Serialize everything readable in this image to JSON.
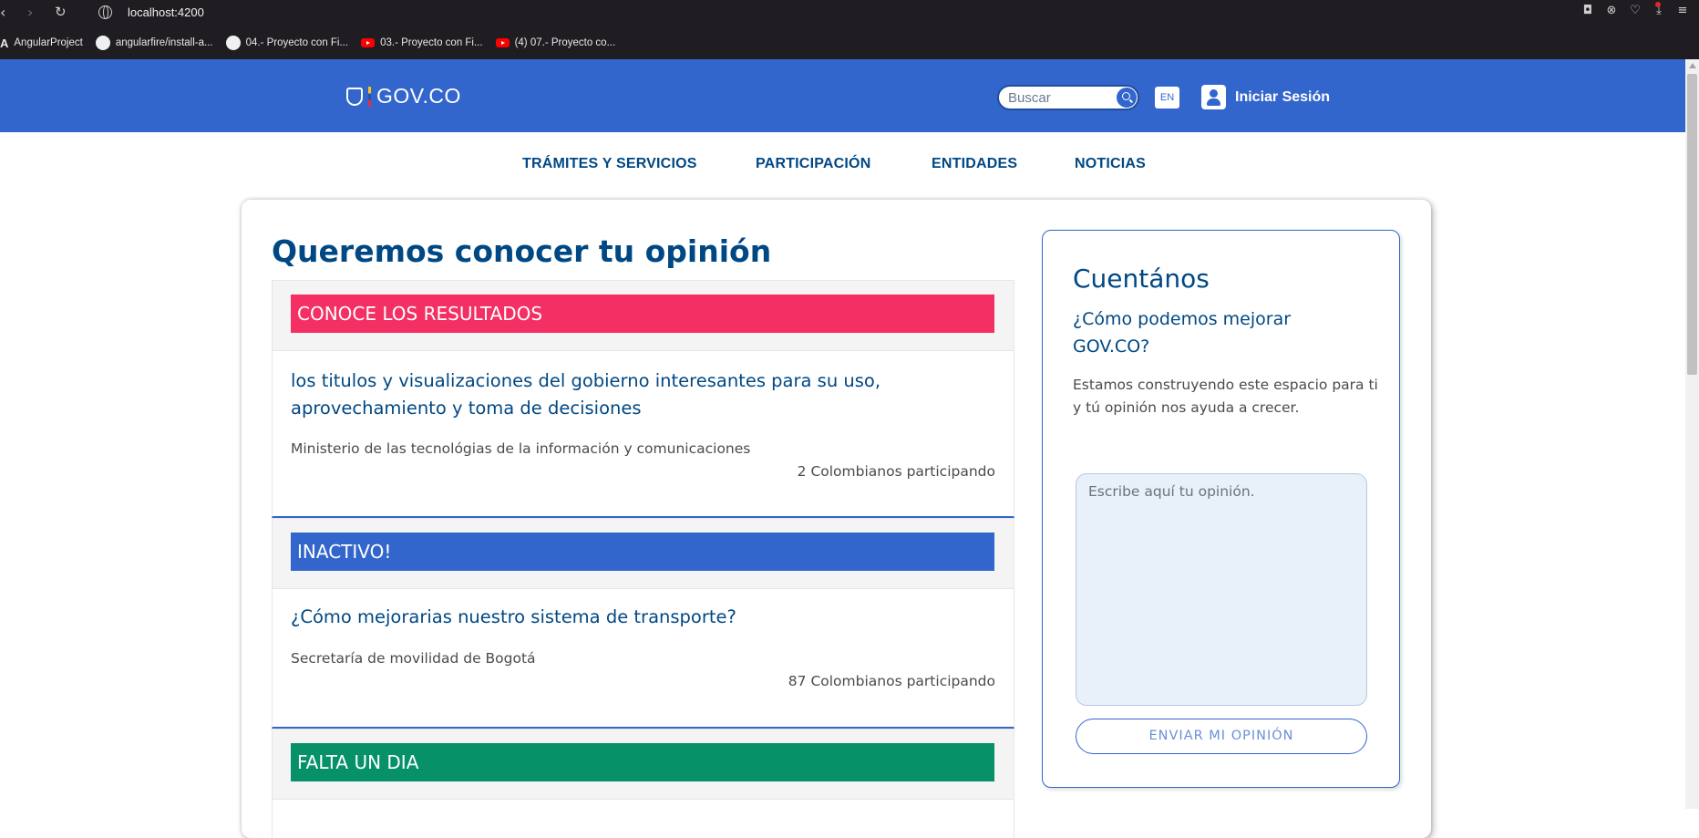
{
  "browser": {
    "url": "localhost:4200",
    "bookmarks": [
      {
        "label": "AngularProject"
      },
      {
        "label": "angularfire/install-a..."
      },
      {
        "label": "04.- Proyecto con Fi..."
      },
      {
        "label": "03.- Proyecto con Fi..."
      },
      {
        "label": "(4) 07.- Proyecto co..."
      }
    ]
  },
  "header": {
    "logo_text": "GOV.CO",
    "search_placeholder": "Buscar",
    "lang_label": "EN",
    "login_label": "Iniciar Sesión"
  },
  "nav": {
    "items": [
      {
        "label": "TRÁMITES Y SERVICIOS"
      },
      {
        "label": "PARTICIPACIÓN"
      },
      {
        "label": "ENTIDADES"
      },
      {
        "label": "NOTICIAS"
      }
    ]
  },
  "main": {
    "title": "Queremos conocer tu opinión",
    "items": [
      {
        "status": "CONOCE LOS RESULTADOS",
        "status_color": "#f42f63",
        "title": "los titulos y visualizaciones del gobierno interesantes para su uso, aprovechamiento y toma de decisiones",
        "org": "Ministerio de las tecnológias de la información y comunicaciones",
        "count": "2 Colombianos participando"
      },
      {
        "status": "INACTIVO!",
        "status_color": "#3366cc",
        "title": "¿Cómo mejorarias nuestro sistema de transporte?",
        "org": "Secretaría de movilidad de Bogotá",
        "count": "87 Colombianos participando"
      },
      {
        "status": "FALTA UN DIA",
        "status_color": "#069169"
      }
    ]
  },
  "side": {
    "title": "Cuentános",
    "question": "¿Cómo podemos mejorar GOV.CO?",
    "text": "Estamos construyendo este espacio para ti y tú opinión nos ayuda a crecer.",
    "textarea_placeholder": "Escribe aquí tu opinión.",
    "button_label": "ENVIAR MI OPINIÓN"
  },
  "colors": {
    "header_bg": "#3366cc",
    "primary_text": "#004884"
  }
}
